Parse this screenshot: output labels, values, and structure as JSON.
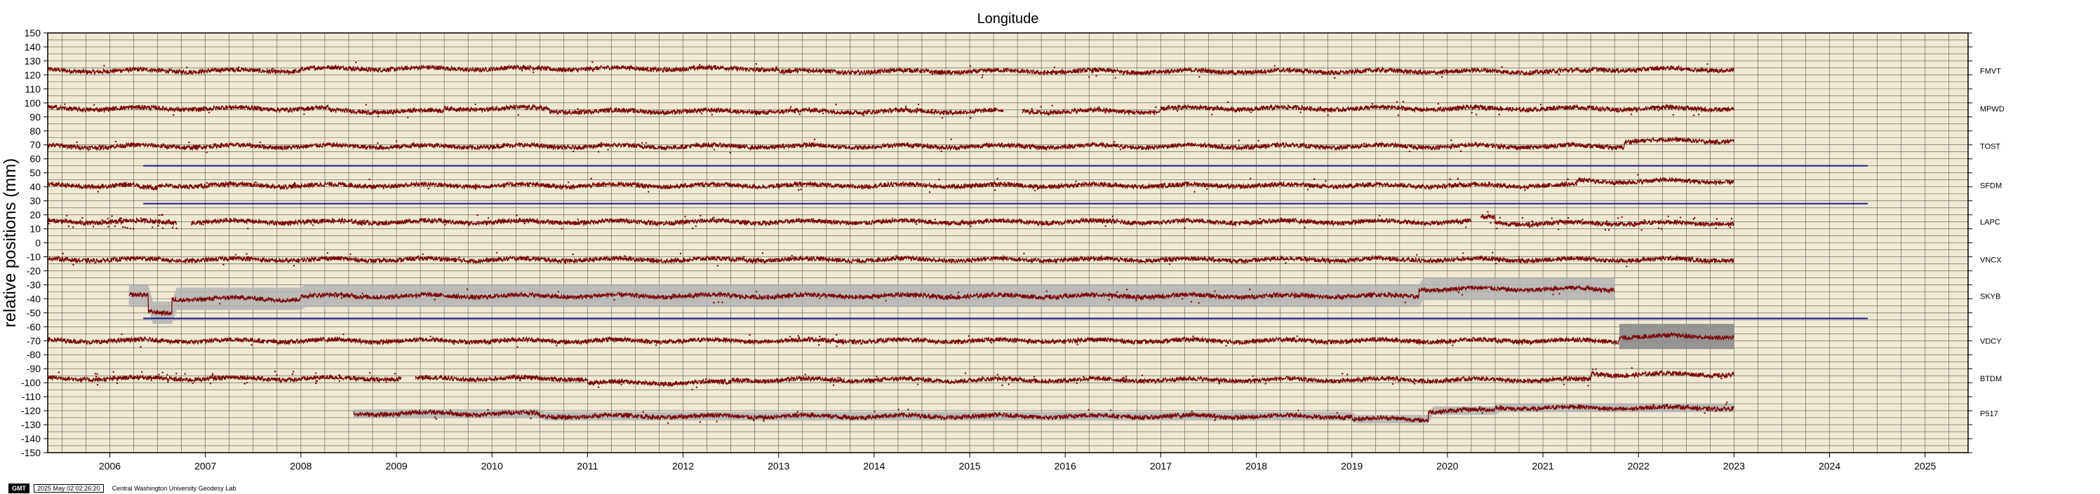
{
  "footer": {
    "logo": "GMT",
    "timestamp": "2025 May 02 02:26:20",
    "credit": "Central Washington University Geodesy Lab"
  },
  "chart_data": {
    "type": "line",
    "title": "Longitude",
    "xlabel": "",
    "ylabel": "relative positions (mm)",
    "xlim": [
      2005.35,
      2025.45
    ],
    "ylim": [
      -150,
      150
    ],
    "grid": true,
    "x_ticks": [
      2006,
      2007,
      2008,
      2009,
      2010,
      2011,
      2012,
      2013,
      2014,
      2015,
      2016,
      2017,
      2018,
      2019,
      2020,
      2021,
      2022,
      2023,
      2024,
      2025
    ],
    "y_ticks": [
      150,
      140,
      130,
      120,
      110,
      100,
      90,
      80,
      70,
      60,
      50,
      40,
      30,
      20,
      10,
      0,
      -10,
      -20,
      -30,
      -40,
      -50,
      -60,
      -70,
      -80,
      -90,
      -100,
      -110,
      -120,
      -130,
      -140,
      -150
    ],
    "colors": {
      "background": "#efe9d4",
      "grid": "#555555",
      "data": "#7a0a0a",
      "band": "#b3b3b3",
      "band_dark": "#8c8c8c",
      "reference": "#1a1a8c"
    },
    "series": [
      {
        "name": "FMVT",
        "offset": 123,
        "segments": [
          [
            2005.35,
            2023.0
          ]
        ],
        "changes": [
          [
            2005.35,
            0
          ],
          [
            2008.0,
            1.5
          ],
          [
            2013.0,
            -0.5
          ],
          [
            2021.5,
            1.0
          ]
        ],
        "band": 0
      },
      {
        "name": "MPWD",
        "offset": 96,
        "segments": [
          [
            2005.35,
            2015.35
          ],
          [
            2015.55,
            2023.0
          ]
        ],
        "changes": [
          [
            2005.35,
            0
          ],
          [
            2008.3,
            -2
          ],
          [
            2009.5,
            0
          ],
          [
            2010.6,
            -2
          ],
          [
            2017.0,
            0
          ]
        ],
        "band": 0
      },
      {
        "name": "TOST",
        "offset": 69,
        "segments": [
          [
            2005.35,
            2023.0
          ]
        ],
        "changes": [
          [
            2005.35,
            0
          ],
          [
            2021.85,
            4
          ]
        ],
        "band": 0
      },
      {
        "name": "SFDM",
        "offset": 41,
        "segments": [
          [
            2005.35,
            2023.0
          ]
        ],
        "changes": [
          [
            2005.35,
            0
          ],
          [
            2006.3,
            -2
          ],
          [
            2006.5,
            0
          ],
          [
            2021.35,
            3
          ]
        ],
        "band": 0
      },
      {
        "name": "LAPC",
        "offset": 15,
        "segments": [
          [
            2005.35,
            2006.7
          ],
          [
            2006.85,
            2020.25
          ],
          [
            2020.35,
            2023.0
          ]
        ],
        "changes": [
          [
            2005.35,
            0
          ],
          [
            2020.35,
            3
          ],
          [
            2020.5,
            -1
          ]
        ],
        "band": 0
      },
      {
        "name": "VNCX",
        "offset": -12,
        "segments": [
          [
            2005.35,
            2023.0
          ]
        ],
        "changes": [
          [
            2005.35,
            0
          ]
        ],
        "band": 0
      },
      {
        "name": "SKYB",
        "offset": -38,
        "segments": [
          [
            2006.2,
            2021.75
          ]
        ],
        "changes": [
          [
            2006.2,
            0
          ],
          [
            2006.4,
            -12
          ],
          [
            2006.65,
            -2
          ],
          [
            2008.0,
            0
          ],
          [
            2019.7,
            5
          ]
        ],
        "band": 8
      },
      {
        "name": "VDCY",
        "offset": -70,
        "segments": [
          [
            2005.35,
            2023.0
          ]
        ],
        "changes": [
          [
            2005.35,
            0
          ],
          [
            2021.8,
            3
          ]
        ],
        "band": 0,
        "late_band": [
          2021.8,
          2023.0,
          9
        ]
      },
      {
        "name": "BTDM",
        "offset": -97,
        "segments": [
          [
            2005.35,
            2009.05
          ],
          [
            2009.2,
            2023.0
          ]
        ],
        "changes": [
          [
            2005.35,
            0
          ],
          [
            2011.0,
            -3
          ],
          [
            2012.5,
            -1
          ],
          [
            2021.5,
            3
          ]
        ],
        "band": 0
      },
      {
        "name": "P517",
        "offset": -122,
        "segments": [
          [
            2008.55,
            2023.0
          ]
        ],
        "changes": [
          [
            2008.55,
            0
          ],
          [
            2010.5,
            -2
          ],
          [
            2019.0,
            -4
          ],
          [
            2019.8,
            2
          ],
          [
            2020.5,
            4
          ]
        ],
        "band": 3
      }
    ],
    "reference_lines": [
      {
        "y": 55,
        "x": [
          2006.35,
          2024.4
        ]
      },
      {
        "y": 28,
        "x": [
          2006.35,
          2024.4
        ]
      },
      {
        "y": -54,
        "x": [
          2006.35,
          2024.4
        ]
      }
    ]
  }
}
